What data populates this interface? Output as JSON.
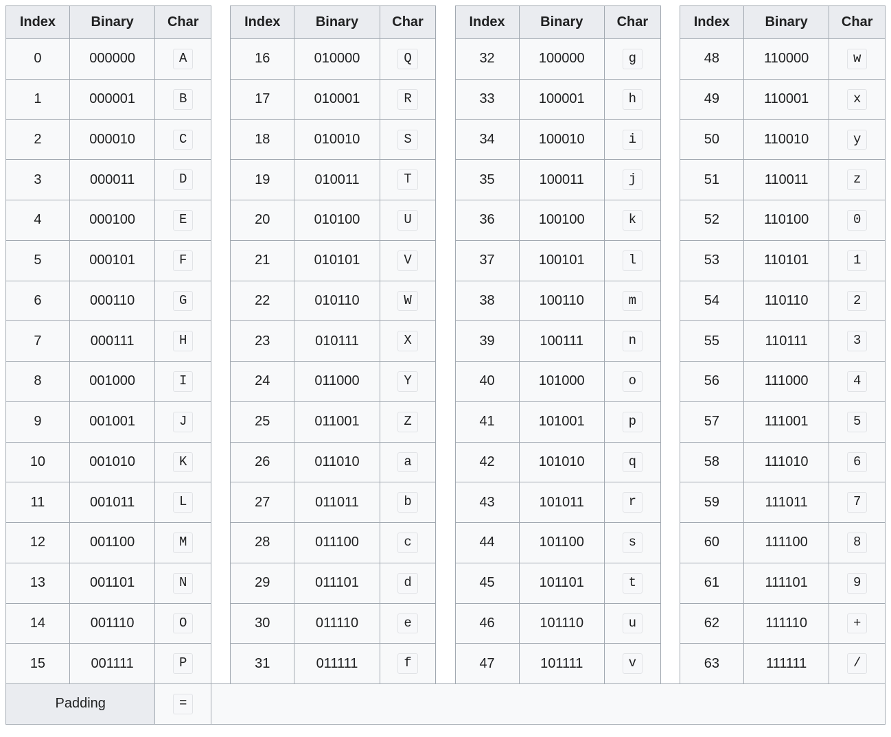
{
  "headers": {
    "index": "Index",
    "binary": "Binary",
    "char": "Char"
  },
  "padding": {
    "label": "Padding",
    "char": "="
  },
  "columns": [
    [
      {
        "index": "0",
        "binary": "000000",
        "char": "A"
      },
      {
        "index": "1",
        "binary": "000001",
        "char": "B"
      },
      {
        "index": "2",
        "binary": "000010",
        "char": "C"
      },
      {
        "index": "3",
        "binary": "000011",
        "char": "D"
      },
      {
        "index": "4",
        "binary": "000100",
        "char": "E"
      },
      {
        "index": "5",
        "binary": "000101",
        "char": "F"
      },
      {
        "index": "6",
        "binary": "000110",
        "char": "G"
      },
      {
        "index": "7",
        "binary": "000111",
        "char": "H"
      },
      {
        "index": "8",
        "binary": "001000",
        "char": "I"
      },
      {
        "index": "9",
        "binary": "001001",
        "char": "J"
      },
      {
        "index": "10",
        "binary": "001010",
        "char": "K"
      },
      {
        "index": "11",
        "binary": "001011",
        "char": "L"
      },
      {
        "index": "12",
        "binary": "001100",
        "char": "M"
      },
      {
        "index": "13",
        "binary": "001101",
        "char": "N"
      },
      {
        "index": "14",
        "binary": "001110",
        "char": "O"
      },
      {
        "index": "15",
        "binary": "001111",
        "char": "P"
      }
    ],
    [
      {
        "index": "16",
        "binary": "010000",
        "char": "Q"
      },
      {
        "index": "17",
        "binary": "010001",
        "char": "R"
      },
      {
        "index": "18",
        "binary": "010010",
        "char": "S"
      },
      {
        "index": "19",
        "binary": "010011",
        "char": "T"
      },
      {
        "index": "20",
        "binary": "010100",
        "char": "U"
      },
      {
        "index": "21",
        "binary": "010101",
        "char": "V"
      },
      {
        "index": "22",
        "binary": "010110",
        "char": "W"
      },
      {
        "index": "23",
        "binary": "010111",
        "char": "X"
      },
      {
        "index": "24",
        "binary": "011000",
        "char": "Y"
      },
      {
        "index": "25",
        "binary": "011001",
        "char": "Z"
      },
      {
        "index": "26",
        "binary": "011010",
        "char": "a"
      },
      {
        "index": "27",
        "binary": "011011",
        "char": "b"
      },
      {
        "index": "28",
        "binary": "011100",
        "char": "c"
      },
      {
        "index": "29",
        "binary": "011101",
        "char": "d"
      },
      {
        "index": "30",
        "binary": "011110",
        "char": "e"
      },
      {
        "index": "31",
        "binary": "011111",
        "char": "f"
      }
    ],
    [
      {
        "index": "32",
        "binary": "100000",
        "char": "g"
      },
      {
        "index": "33",
        "binary": "100001",
        "char": "h"
      },
      {
        "index": "34",
        "binary": "100010",
        "char": "i"
      },
      {
        "index": "35",
        "binary": "100011",
        "char": "j"
      },
      {
        "index": "36",
        "binary": "100100",
        "char": "k"
      },
      {
        "index": "37",
        "binary": "100101",
        "char": "l"
      },
      {
        "index": "38",
        "binary": "100110",
        "char": "m"
      },
      {
        "index": "39",
        "binary": "100111",
        "char": "n"
      },
      {
        "index": "40",
        "binary": "101000",
        "char": "o"
      },
      {
        "index": "41",
        "binary": "101001",
        "char": "p"
      },
      {
        "index": "42",
        "binary": "101010",
        "char": "q"
      },
      {
        "index": "43",
        "binary": "101011",
        "char": "r"
      },
      {
        "index": "44",
        "binary": "101100",
        "char": "s"
      },
      {
        "index": "45",
        "binary": "101101",
        "char": "t"
      },
      {
        "index": "46",
        "binary": "101110",
        "char": "u"
      },
      {
        "index": "47",
        "binary": "101111",
        "char": "v"
      }
    ],
    [
      {
        "index": "48",
        "binary": "110000",
        "char": "w"
      },
      {
        "index": "49",
        "binary": "110001",
        "char": "x"
      },
      {
        "index": "50",
        "binary": "110010",
        "char": "y"
      },
      {
        "index": "51",
        "binary": "110011",
        "char": "z"
      },
      {
        "index": "52",
        "binary": "110100",
        "char": "0"
      },
      {
        "index": "53",
        "binary": "110101",
        "char": "1"
      },
      {
        "index": "54",
        "binary": "110110",
        "char": "2"
      },
      {
        "index": "55",
        "binary": "110111",
        "char": "3"
      },
      {
        "index": "56",
        "binary": "111000",
        "char": "4"
      },
      {
        "index": "57",
        "binary": "111001",
        "char": "5"
      },
      {
        "index": "58",
        "binary": "111010",
        "char": "6"
      },
      {
        "index": "59",
        "binary": "111011",
        "char": "7"
      },
      {
        "index": "60",
        "binary": "111100",
        "char": "8"
      },
      {
        "index": "61",
        "binary": "111101",
        "char": "9"
      },
      {
        "index": "62",
        "binary": "111110",
        "char": "+"
      },
      {
        "index": "63",
        "binary": "111111",
        "char": "/"
      }
    ]
  ]
}
